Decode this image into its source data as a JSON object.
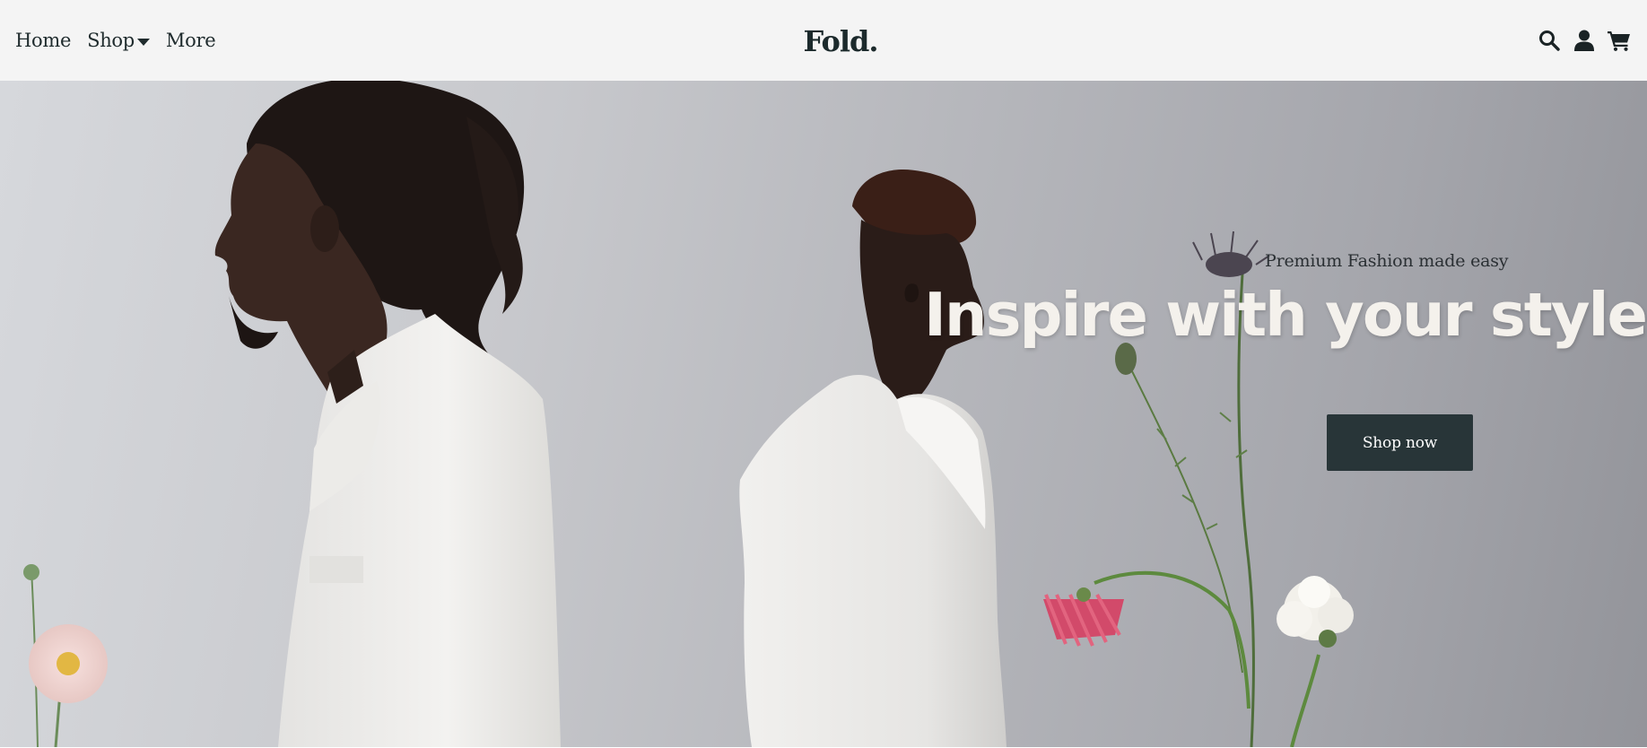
{
  "nav": {
    "links": {
      "home": "Home",
      "shop": "Shop",
      "more": "More"
    },
    "brand": "Fold.",
    "icons": [
      "search-icon",
      "user-icon",
      "cart-icon"
    ]
  },
  "hero": {
    "subtitle": "Premium Fashion made easy",
    "title": "Inspire with your style",
    "cta_label": "Shop now"
  },
  "colors": {
    "nav_bg": "#f4f4f4",
    "text_dark": "#1f2b2d",
    "button_bg": "#283538",
    "title_text": "#f4f1ec"
  }
}
